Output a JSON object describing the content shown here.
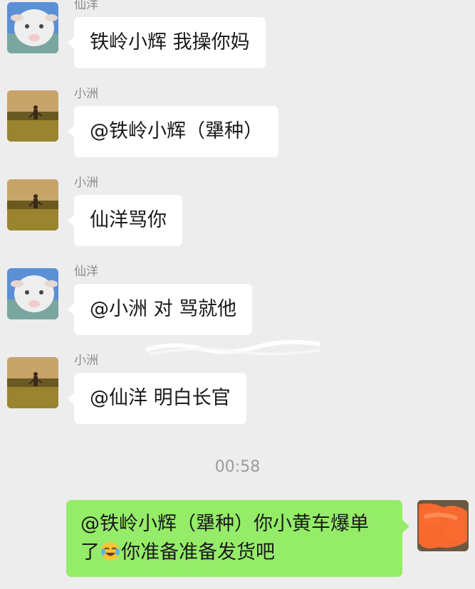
{
  "messages": [
    {
      "sender": "仙洋",
      "text": "铁岭小辉 我操你妈",
      "avatar": "goat-avatar"
    },
    {
      "sender": "小洲",
      "text": "@铁岭小辉（犟种）",
      "avatar": "field-runner-avatar"
    },
    {
      "sender": "小洲",
      "text": "仙洋骂你",
      "avatar": "field-runner-avatar"
    },
    {
      "sender": "仙洋",
      "text": "@小洲 对 骂就他",
      "avatar": "goat-avatar"
    },
    {
      "sender": "小洲",
      "text": "@仙洋 明白长官",
      "avatar": "field-runner-avatar"
    }
  ],
  "timestamp": "00:58",
  "self_message": {
    "line1": "@铁岭小辉（犟种）你小黄车爆单",
    "line2_prefix": "了",
    "emoji": "crying-laughing-emoji",
    "line2_suffix": "你准备准备发货吧"
  },
  "colors": {
    "background": "#ededed",
    "incoming_bubble": "#ffffff",
    "outgoing_bubble": "#95ec69",
    "sender_name": "#8a8a8a"
  }
}
